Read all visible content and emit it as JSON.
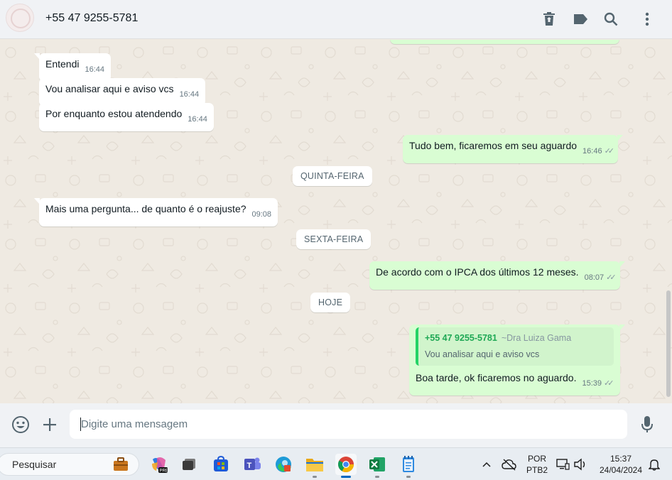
{
  "header": {
    "contact_name": "+55 47 9255-5781"
  },
  "messages": [
    {
      "dir": "in",
      "text": "Entendi",
      "time": "16:44"
    },
    {
      "dir": "in",
      "text": "Vou analisar aqui e aviso vcs",
      "time": "16:44"
    },
    {
      "dir": "in",
      "text": "Por enquanto estou atendendo",
      "time": "16:44"
    },
    {
      "dir": "out",
      "text": "Tudo bem, ficaremos em seu aguardo",
      "time": "16:46",
      "status": "read"
    },
    {
      "dir": "in",
      "text": "Mais uma pergunta... de quanto é o reajuste?",
      "time": "09:08"
    },
    {
      "dir": "out",
      "text": "De acordo com o IPCA dos últimos 12 meses.",
      "time": "08:07",
      "status": "read"
    },
    {
      "dir": "out",
      "text": "Boa tarde, ok ficaremos no aguardo.",
      "time": "15:39",
      "status": "read",
      "quote": {
        "author": "+55 47 9255-5781",
        "pushname": "~Dra Luiza Gama",
        "text": "Vou analisar aqui e aviso vcs"
      }
    }
  ],
  "day_separators": [
    "QUINTA-FEIRA",
    "SEXTA-FEIRA",
    "HOJE"
  ],
  "composer": {
    "placeholder": "Digite uma mensagem"
  },
  "taskbar": {
    "search_label": "Pesquisar",
    "language_top": "POR",
    "language_bottom": "PTB2",
    "time": "15:37",
    "date": "24/04/2024"
  },
  "colors": {
    "outgoing_bubble": "#d9fdd3",
    "incoming_bubble": "#ffffff",
    "chat_background": "#efeae2",
    "quote_accent": "#25d366",
    "read_ticks": "#8696a0"
  },
  "icons": {
    "header": [
      "delete-icon",
      "label-icon",
      "search-icon",
      "menu-icon"
    ],
    "composer": [
      "emoji-icon",
      "attach-plus-icon",
      "microphone-icon"
    ],
    "taskbar": [
      "search-icon",
      "briefcase-icon",
      "copilot-icon",
      "task-view-icon",
      "store-icon",
      "teams-icon",
      "edge-icon",
      "file-explorer-icon",
      "chrome-icon",
      "excel-icon",
      "notepad-icon",
      "chevron-up-icon",
      "cloud-off-icon",
      "monitor-icon",
      "volume-icon",
      "bell-icon"
    ]
  }
}
